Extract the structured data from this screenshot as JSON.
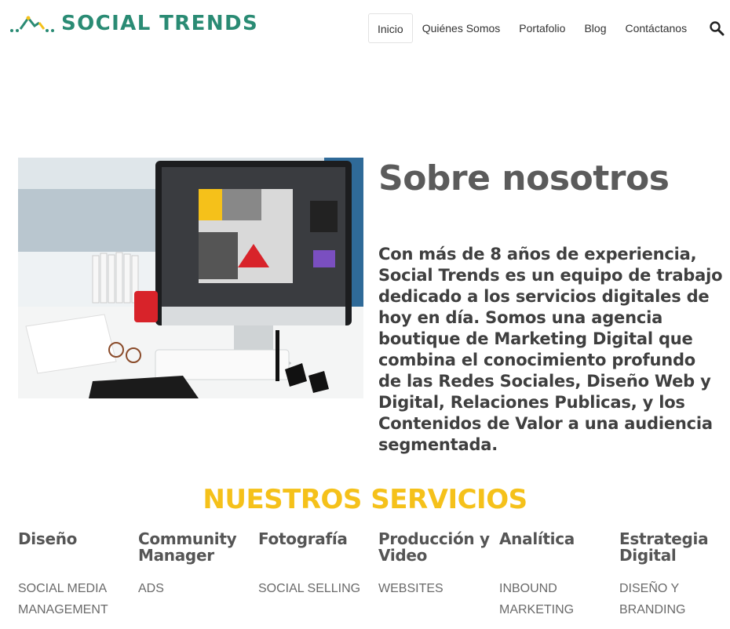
{
  "header": {
    "logo_text": "SOCIAL TRENDS",
    "brand_color": "#2a8b74",
    "nav": [
      "Inicio",
      "Quiénes Somos",
      "Portafolio",
      "Blog",
      "Contáctanos"
    ],
    "active_nav": "Inicio",
    "search_icon": "search-icon"
  },
  "about": {
    "title": "Sobre nosotros",
    "text": "Con más de 8 años de experiencia, Social Trends es un equipo de trabajo dedicado a los servicios digitales de hoy en día. Somos una agencia boutique de Marketing Digital que combina el conocimiento profundo de las Redes Sociales, Diseño Web y Digital, Relaciones Publicas, y los Contenidos de Valor a una audiencia segmentada."
  },
  "services": {
    "title": "NUESTROS SERVICIOS",
    "title_color": "#f5c11a",
    "columns": [
      {
        "heading": "Diseño",
        "item": "SOCIAL MEDIA MANAGEMENT"
      },
      {
        "heading": "Community Manager",
        "item": "ADS"
      },
      {
        "heading": "Fotografía",
        "item": "SOCIAL SELLING"
      },
      {
        "heading": "Producción y Video",
        "item": "WEBSITES"
      },
      {
        "heading": "Analítica",
        "item": "INBOUND MARKETING"
      },
      {
        "heading": "Estrategia Digital",
        "item": "DISEÑO Y BRANDING"
      }
    ]
  }
}
